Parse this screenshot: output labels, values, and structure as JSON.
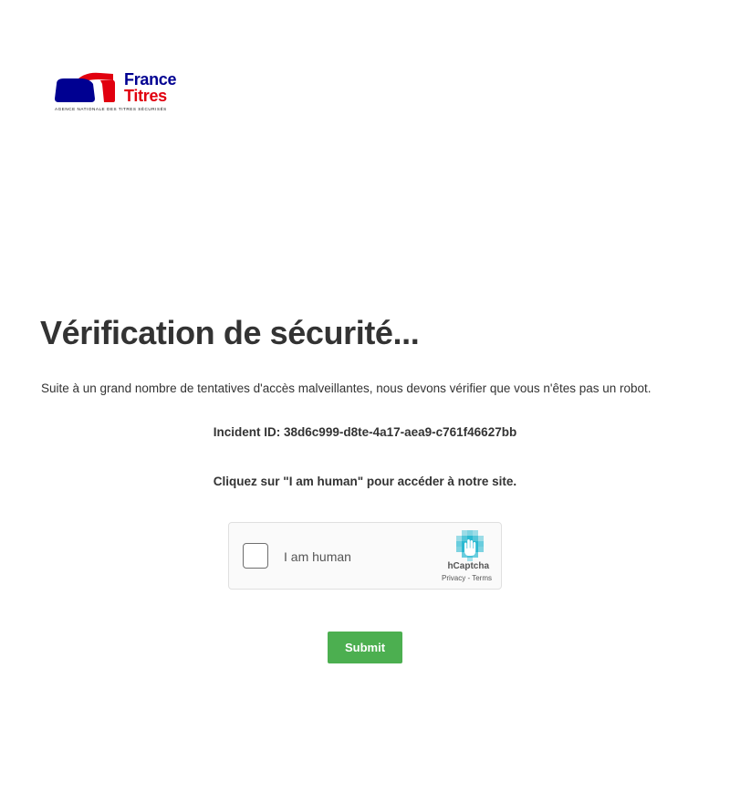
{
  "logo": {
    "name_line1": "France",
    "name_line2": "Titres",
    "tagline": "AGENCE NATIONALE DES TITRES SÉCURISÉS",
    "colors": {
      "blue": "#000091",
      "red": "#e1000f"
    }
  },
  "title": "Vérification de sécurité...",
  "intro": "Suite à un grand nombre de tentatives d'accès malveillantes, nous devons vérifier que vous n'êtes pas un robot.",
  "incident": "Incident ID: 38d6c999-d8te-4a17-aea9-c761f46627bb",
  "instruction": "Cliquez sur \"I am human\" pour accéder à notre site.",
  "captcha": {
    "label": "I am human",
    "brand": "hCaptcha",
    "privacy": "Privacy",
    "separator": " - ",
    "terms": "Terms",
    "checked": false,
    "icon": "hcaptcha-hand-icon",
    "accent": "#2bb9d1"
  },
  "submit": {
    "label": "Submit",
    "color": "#4caf50"
  }
}
